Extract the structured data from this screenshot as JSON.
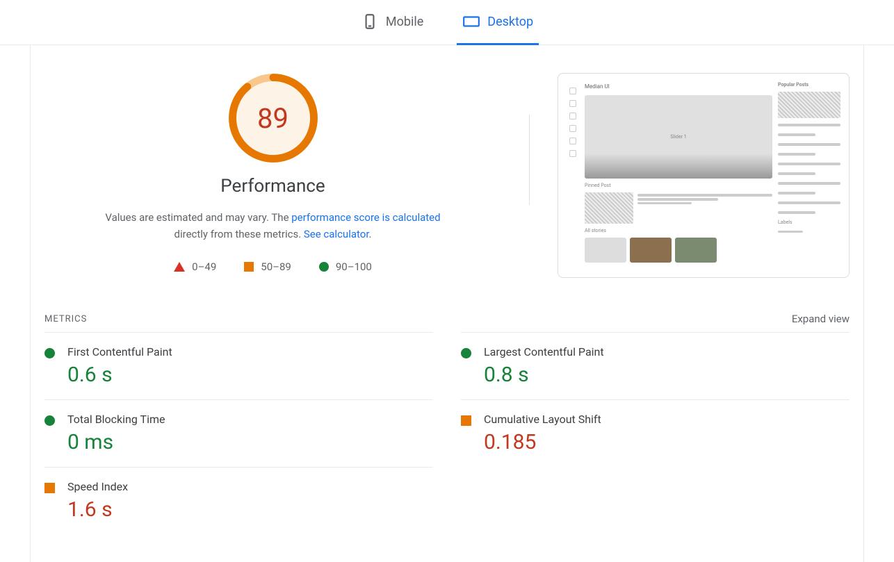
{
  "tabs": {
    "mobile": "Mobile",
    "desktop": "Desktop"
  },
  "performance": {
    "score": "89",
    "title": "Performance",
    "desc_prefix": "Values are estimated and may vary. The ",
    "desc_link1": "performance score is calculated",
    "desc_mid": " directly from these metrics. ",
    "desc_link2": "See calculator",
    "desc_suffix": "."
  },
  "legend": {
    "poor": "0–49",
    "avg": "50–89",
    "good": "90–100"
  },
  "metricsSection": {
    "label": "METRICS",
    "expand": "Expand view"
  },
  "metrics": {
    "fcp_name": "First Contentful Paint",
    "fcp_value": "0.6 s",
    "lcp_name": "Largest Contentful Paint",
    "lcp_value": "0.8 s",
    "tbt_name": "Total Blocking Time",
    "tbt_value": "0 ms",
    "cls_name": "Cumulative Layout Shift",
    "cls_value": "0.185",
    "si_name": "Speed Index",
    "si_value": "1.6 s"
  },
  "preview": {
    "site_title": "Median UI",
    "side_header": "Popular Posts",
    "pinned_label": "Pinned Post",
    "slider_label": "Slider 1",
    "all_stories": "All stories",
    "labels": "Labels"
  }
}
